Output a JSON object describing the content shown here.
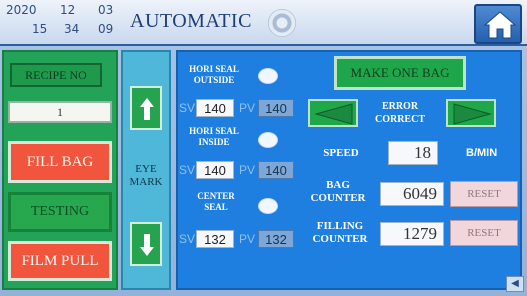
{
  "header": {
    "date": {
      "year": "2020",
      "month": "12",
      "day": "03"
    },
    "time": {
      "hour": "15",
      "minute": "34",
      "second": "09"
    },
    "title": "AUTOMATIC"
  },
  "left": {
    "recipe_label": "RECIPE NO",
    "recipe_value": "1",
    "fill_bag": "FILL BAG",
    "testing": "TESTING",
    "film_pull": "FILM PULL"
  },
  "eye_mark": {
    "label": "EYE MARK"
  },
  "seals": {
    "hori_outside": {
      "label": "HORI SEAL OUTSIDE",
      "sv": "140",
      "pv": "140"
    },
    "hori_inside": {
      "label": "HORI SEAL INSIDE",
      "sv": "140",
      "pv": "140"
    },
    "center": {
      "label": "CENTER SEAL",
      "sv": "132",
      "pv": "132"
    },
    "sv_label": "SV",
    "pv_label": "PV"
  },
  "controls": {
    "make_one_bag": "MAKE ONE BAG",
    "error_correct": "ERROR CORRECT",
    "speed_label": "SPEED",
    "speed_value": "18",
    "speed_unit": "B/MIN",
    "bag_counter_label": "BAG COUNTER",
    "bag_counter_value": "6049",
    "filling_counter_label": "FILLING COUNTER",
    "filling_counter_value": "1279",
    "reset_label": "RESET"
  },
  "colors": {
    "main_panel": "#1e7fe0",
    "green_button": "#20a64a",
    "red_button": "#f2553e",
    "reset_button": "#f1d6dc"
  },
  "icons": {
    "home": "home-icon",
    "up_arrow": "arrow-up-icon",
    "down_arrow": "arrow-down-icon",
    "left_arrow": "triangle-left-icon",
    "right_arrow": "triangle-right-icon"
  }
}
